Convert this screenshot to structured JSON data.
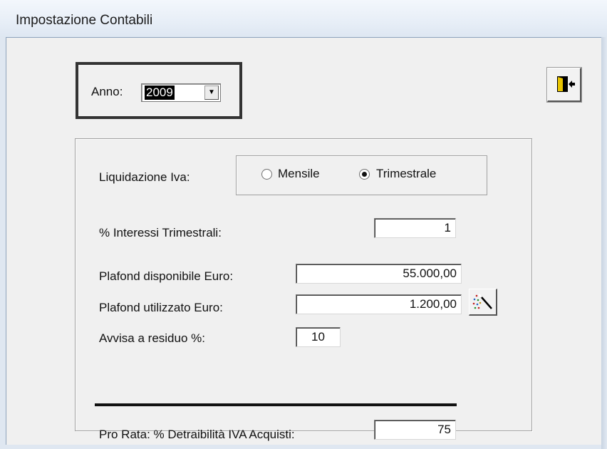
{
  "window": {
    "title": "Impostazione Contabili"
  },
  "anno": {
    "label": "Anno:",
    "value": "2009"
  },
  "exit_button": {
    "icon": "exit-door-icon"
  },
  "liquidazione": {
    "label": "Liquidazione Iva:",
    "options": [
      {
        "label": "Mensile",
        "selected": false
      },
      {
        "label": "Trimestrale",
        "selected": true
      }
    ]
  },
  "interessi": {
    "label": "% Interessi Trimestrali:",
    "value": "1"
  },
  "plafond_disponibile": {
    "label": "Plafond disponibile Euro:",
    "value": "55.000,00"
  },
  "plafond_utilizzato": {
    "label": "Plafond utilizzato Euro:",
    "value": "1.200,00"
  },
  "wand_button": {
    "icon": "magic-wand-icon"
  },
  "avvisa": {
    "label": "Avvisa a residuo %:",
    "value": "10"
  },
  "pro_rata": {
    "label": "Pro Rata: % Detraibilità IVA Acquisti:",
    "value": "75"
  }
}
